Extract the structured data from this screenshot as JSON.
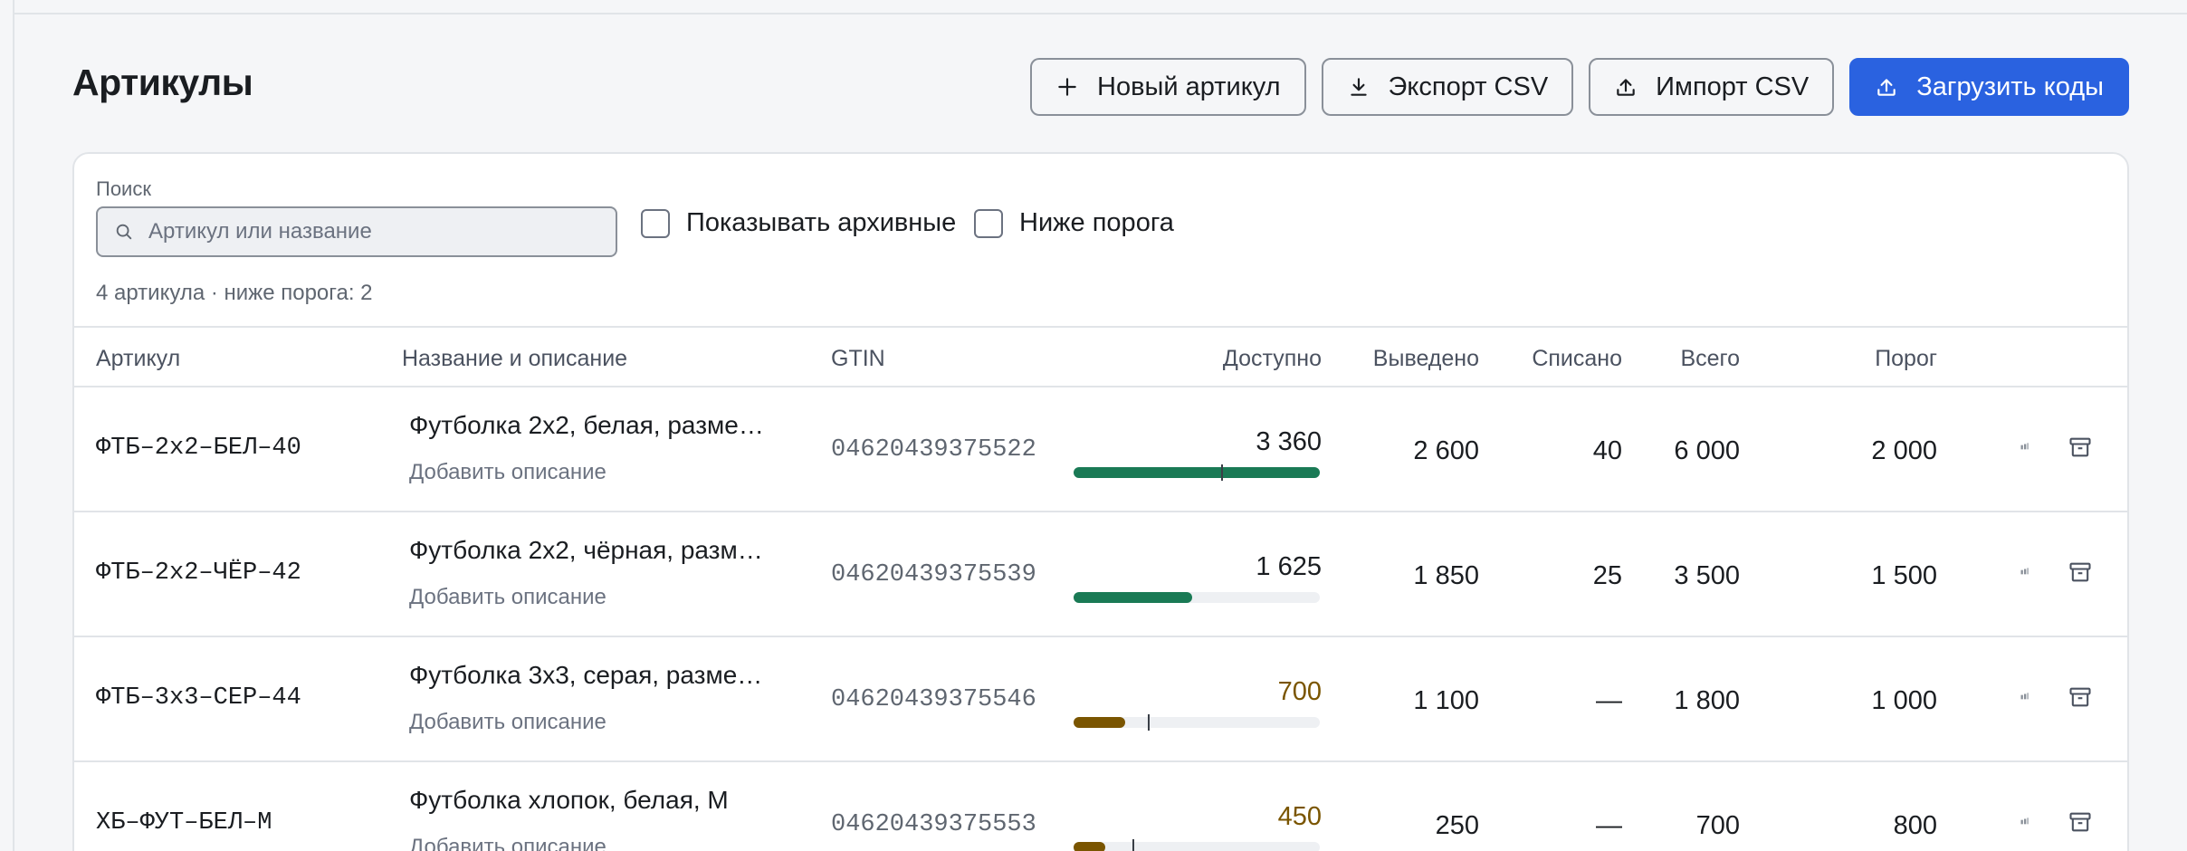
{
  "page": {
    "title": "Артикулы"
  },
  "actions": {
    "new_item": "Новый артикул",
    "export_csv": "Экспорт CSV",
    "import_csv": "Импорт CSV",
    "upload_codes": "Загрузить коды"
  },
  "filters": {
    "search_label": "Поиск",
    "search_placeholder": "Артикул или название",
    "search_value": "",
    "show_archived": "Показывать архивные",
    "show_archived_checked": false,
    "below_threshold": "Ниже порога",
    "below_threshold_checked": false
  },
  "summary": "4 артикула · ниже порога: 2",
  "table": {
    "headers": {
      "sku": "Артикул",
      "name": "Название и описание",
      "gtin": "GTIN",
      "available": "Доступно",
      "withdrawn": "Выведено",
      "written_off": "Списано",
      "total": "Всего",
      "threshold": "Порог"
    },
    "rows": [
      {
        "sku": "ФТБ–2х2–БЕЛ–40",
        "name": "Футболка 2х2, белая, разме…",
        "desc": "Добавить описание",
        "gtin": "04620439375522",
        "available": "3 360",
        "available_ratio": 1.0,
        "threshold_ratio": 0.6,
        "status": "ok",
        "withdrawn": "2 600",
        "written_off": "40",
        "total": "6 000",
        "threshold": "2 000"
      },
      {
        "sku": "ФТБ–2х2–ЧЁР–42",
        "name": "Футболка 2х2, чёрная, разм…",
        "desc": "Добавить описание",
        "gtin": "04620439375539",
        "available": "1 625",
        "available_ratio": 0.48,
        "threshold_ratio": null,
        "status": "ok",
        "withdrawn": "1 850",
        "written_off": "25",
        "total": "3 500",
        "threshold": "1 500"
      },
      {
        "sku": "ФТБ–3х3–СЕР–44",
        "name": "Футболка 3х3, серая, разме…",
        "desc": "Добавить описание",
        "gtin": "04620439375546",
        "available": "700",
        "available_ratio": 0.21,
        "threshold_ratio": 0.3,
        "status": "warn",
        "withdrawn": "1 100",
        "written_off": "—",
        "total": "1 800",
        "threshold": "1 000"
      },
      {
        "sku": "ХБ–ФУТ–БЕЛ–М",
        "name": "Футболка хлопок, белая, M",
        "desc": "Добавить описание",
        "gtin": "04620439375553",
        "available": "450",
        "available_ratio": 0.13,
        "threshold_ratio": 0.24,
        "status": "warn",
        "withdrawn": "250",
        "written_off": "—",
        "total": "700",
        "threshold": "800"
      }
    ]
  },
  "colors": {
    "accent": "#2a62e0",
    "ok_bar": "#1a7a55",
    "warn_bar": "#7a5500",
    "warn_text": "#7a5500"
  },
  "icons": {
    "new": "plus-icon",
    "export": "download-icon",
    "import": "upload-icon",
    "upload": "upload-icon",
    "search": "search-icon",
    "edit": "edit-icon",
    "archive": "archive-icon"
  }
}
